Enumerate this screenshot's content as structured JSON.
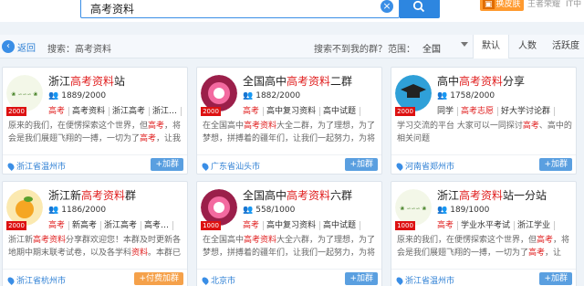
{
  "search": {
    "query": "高考资料",
    "clear_symbol": "×"
  },
  "header_right": {
    "skin_label": "换皮肤",
    "user_name": "王者荣耀",
    "extra": "IT中"
  },
  "subbar": {
    "back_label": "返回",
    "search_label": "搜索：高考资料",
    "cant_find": "搜索不到我的群？",
    "range_label": "范围：",
    "range_value": "全国",
    "sort_tabs": [
      "默认",
      "人数",
      "活跃度"
    ]
  },
  "cards": [
    {
      "title_pre": "浙江",
      "title_hl": "高考资料",
      "title_post": "站",
      "level": "2000",
      "members": "1889/2000",
      "tags": [
        {
          "t": "高考",
          "hl": true
        },
        {
          "t": "高考资料",
          "hl": false
        },
        {
          "t": "浙江高考",
          "hl": false
        },
        {
          "t": "浙江…",
          "hl": false
        }
      ],
      "desc_a": "原来的我们，在便愣探索这个世界，但",
      "desc_hl1": "高考",
      "desc_b": "，将会是我们展翅飞翔的一搏，一切为了",
      "desc_hl2": "高考",
      "desc_c": "，让我们…",
      "location": "浙江省温州市",
      "join": "+加群",
      "join_type": "normal",
      "avatar": "green"
    },
    {
      "title_pre": "全国高中",
      "title_hl": "高考资料",
      "title_post": "二群",
      "level": "2000",
      "members": "1882/2000",
      "tags": [
        {
          "t": "高考",
          "hl": true
        },
        {
          "t": "高中复习资料",
          "hl": false
        },
        {
          "t": "高中试题",
          "hl": false
        }
      ],
      "desc_a": "在全国高中",
      "desc_hl1": "高考资料",
      "desc_b": "大全二群，为了理想，为了梦想，拼搏着的疆年们，让我们一起努力，为将来…",
      "desc_hl2": "",
      "desc_c": "",
      "location": "广东省汕头市",
      "join": "+加群",
      "join_type": "normal",
      "avatar": "pink"
    },
    {
      "title_pre": "高中",
      "title_hl": "高考资料",
      "title_post": "分享",
      "level": "2000",
      "members": "1758/2000",
      "tags": [
        {
          "t": "同学",
          "hl": false
        },
        {
          "t": "高考志愿",
          "hl": true
        },
        {
          "t": "好大学讨论群",
          "hl": false
        }
      ],
      "desc_a": "学习交流的平台 大家可以一同探讨",
      "desc_hl1": "高考",
      "desc_b": "、高中的相关问题",
      "desc_hl2": "",
      "desc_c": "",
      "location": "河南省郑州市",
      "join": "+加群",
      "join_type": "normal",
      "avatar": "cap"
    },
    {
      "title_pre": "浙江新",
      "title_hl": "高考资料",
      "title_post": "群",
      "level": "2000",
      "members": "1186/2000",
      "tags": [
        {
          "t": "高考",
          "hl": true
        },
        {
          "t": "新高考",
          "hl": false
        },
        {
          "t": "浙江高考",
          "hl": false
        },
        {
          "t": "高考…",
          "hl": false
        }
      ],
      "desc_a": "浙江新",
      "desc_hl1": "高考资料",
      "desc_b": "分享群欢迎您！本群及时更新各地期中期末联考试卷，以及各学科",
      "desc_hl2": "资料",
      "desc_c": "。本群已会有…",
      "location": "浙江省杭州市",
      "join": "+付费加群",
      "join_type": "pay",
      "avatar": "orange"
    },
    {
      "title_pre": "全国高中",
      "title_hl": "高考资料",
      "title_post": "六群",
      "level": "1000",
      "members": "558/1000",
      "tags": [
        {
          "t": "高考",
          "hl": true
        },
        {
          "t": "高中复习资料",
          "hl": false
        },
        {
          "t": "高中试题",
          "hl": false
        }
      ],
      "desc_a": "在全国高中",
      "desc_hl1": "高考资料",
      "desc_b": "大全六群，为了理想，为了梦想，拼搏着的疆年们，让我们一起努力，为将来…",
      "desc_hl2": "",
      "desc_c": "",
      "location": "北京市",
      "join": "+加群",
      "join_type": "normal",
      "avatar": "pink"
    },
    {
      "title_pre": "浙江",
      "title_hl": "高考资料",
      "title_post": "站一分站",
      "level": "1000",
      "members": "189/1000",
      "tags": [
        {
          "t": "高考",
          "hl": true
        },
        {
          "t": "学业水平考试",
          "hl": false
        },
        {
          "t": "浙江学业",
          "hl": false
        }
      ],
      "desc_a": "原来的我们，在便愣探索这个世界，但",
      "desc_hl1": "高考",
      "desc_b": "，将会是我们展翅飞翔的一搏，一切为了",
      "desc_hl2": "高考",
      "desc_c": "，让我…",
      "location": "浙江省温州市",
      "join": "+加群",
      "join_type": "normal",
      "avatar": "green"
    }
  ]
}
